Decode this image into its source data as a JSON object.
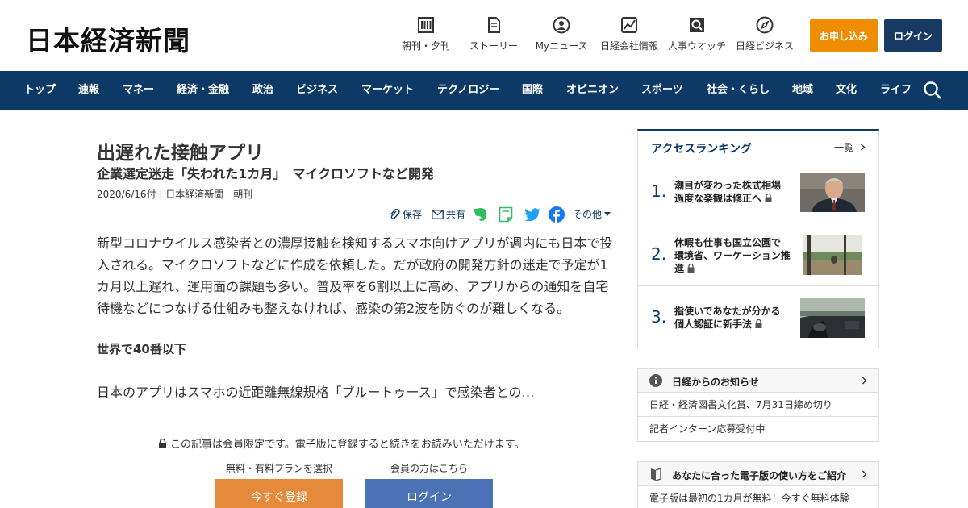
{
  "header": {
    "logo": "日本経済新聞",
    "nav": [
      {
        "label": "朝刊・夕刊",
        "icon": "newspaper-icon"
      },
      {
        "label": "ストーリー",
        "icon": "document-icon"
      },
      {
        "label": "Myニュース",
        "icon": "person-icon"
      },
      {
        "label": "日経会社情報",
        "icon": "chart-icon"
      },
      {
        "label": "人事ウオッチ",
        "icon": "search-person-icon"
      },
      {
        "label": "日経ビジネス",
        "icon": "compass-icon"
      }
    ],
    "apply_label": "お申し込み",
    "login_label": "ログイン"
  },
  "nav": {
    "items": [
      "トップ",
      "速報",
      "マネー",
      "経済・金融",
      "政治",
      "ビジネス",
      "マーケット",
      "テクノロジー",
      "国際",
      "オピニオン",
      "スポーツ",
      "社会・くらし",
      "地域",
      "文化",
      "ライフ"
    ]
  },
  "article": {
    "title": "出遅れた接触アプリ",
    "subtitle": "企業選定迷走「失われた1カ月」　マイクロソフトなど開発",
    "meta": "2020/6/16付 | 日本経済新聞　朝刊",
    "share": {
      "save": "保存",
      "share": "共有",
      "other": "その他"
    },
    "body": "新型コロナウイルス感染者との濃厚接触を検知するスマホ向けアプリが週内にも日本で投入される。マイクロソフトなどに作成を依頼した。だが政府の開発方針の迷走で予定が1カ月以上遅れ、運用面の課題も多い。普及率を6割以上に高め、アプリからの通知を自宅待機などにつなげる仕組みも整えなければ、感染の第2波を防ぐのが難しくなる。",
    "heading": "世界で40番以下",
    "tail": "日本のアプリはスマホの近距離無線規格「ブルートゥース」で感染者との…",
    "member_note": "この記事は会員限定です。電子版に登録すると続きをお読みいただけます。",
    "plan_label": "無料・有料プランを選択",
    "member_label": "会員の方はこちら",
    "register_button": "今すぐ登録",
    "login_button": "ログイン"
  },
  "ranking": {
    "title": "アクセスランキング",
    "all_label": "一覧",
    "items": [
      {
        "num": "1.",
        "line1": "潮目が変わった株式相場",
        "line2": "過度な楽観は修正へ"
      },
      {
        "num": "2.",
        "line1": "休暇も仕事も国立公園で",
        "line2": "環境省、ワーケーション推",
        "line3": "進"
      },
      {
        "num": "3.",
        "line1": "指使いであなたが分かる",
        "line2": "個人認証に新手法"
      }
    ]
  },
  "notice": {
    "title": "日経からのお知らせ",
    "items": [
      "日経・経済図書文化賞、7月31日締め切り",
      "記者インターン応募受付中"
    ]
  },
  "guide": {
    "title": "あなたに合った電子版の使い方をご紹介",
    "items": [
      "電子版は最初の1カ月が無料！今すぐ無料体験"
    ]
  },
  "colors": {
    "navy": "#0c3966",
    "orange": "#f08c00",
    "login_blue": "#4a72b4"
  }
}
